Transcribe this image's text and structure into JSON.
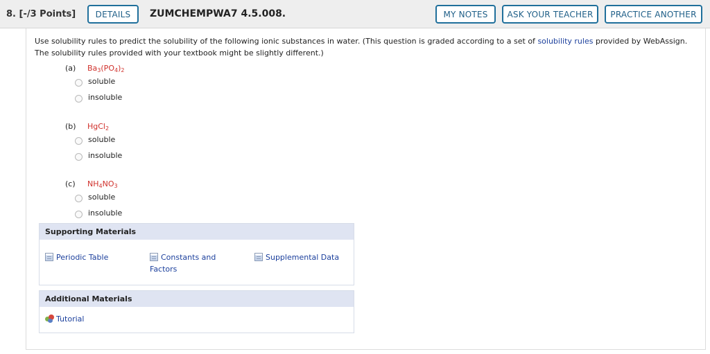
{
  "header": {
    "question_number": "8.",
    "points": "[-/3 Points]",
    "details_label": "DETAILS",
    "question_id": "ZUMCHEMPWA7 4.5.008.",
    "my_notes_label": "MY NOTES",
    "ask_teacher_label": "ASK YOUR TEACHER",
    "practice_another_label": "PRACTICE ANOTHER"
  },
  "instructions": {
    "text_before_link": "Use solubility rules to predict the solubility of the following ionic substances in water. (This question is graded according to a set of ",
    "link_text": "solubility rules",
    "text_after_link": " provided by WebAssign. The solubility rules provided with your textbook might be slightly different.)"
  },
  "parts": [
    {
      "label": "(a)",
      "formula": [
        {
          "t": "Ba",
          "sub": false
        },
        {
          "t": "3",
          "sub": true
        },
        {
          "t": "(PO",
          "sub": false
        },
        {
          "t": "4",
          "sub": true
        },
        {
          "t": ")",
          "sub": false
        },
        {
          "t": "2",
          "sub": true
        }
      ],
      "options": [
        "soluble",
        "insoluble"
      ]
    },
    {
      "label": "(b)",
      "formula": [
        {
          "t": "HgCl",
          "sub": false
        },
        {
          "t": "2",
          "sub": true
        }
      ],
      "options": [
        "soluble",
        "insoluble"
      ]
    },
    {
      "label": "(c)",
      "formula": [
        {
          "t": "NH",
          "sub": false
        },
        {
          "t": "4",
          "sub": true
        },
        {
          "t": "NO",
          "sub": false
        },
        {
          "t": "3",
          "sub": true
        }
      ],
      "options": [
        "soluble",
        "insoluble"
      ]
    }
  ],
  "supporting_materials": {
    "title": "Supporting Materials",
    "links": [
      "Periodic Table",
      "Constants and Factors",
      "Supplemental Data"
    ],
    "icon": "document-icon"
  },
  "additional_materials": {
    "title": "Additional Materials",
    "links": [
      "Tutorial"
    ],
    "icon": "tutorial-icon"
  },
  "colors": {
    "accent": "#1f6f9b",
    "formula": "#d0302b",
    "link": "#1b3f9c",
    "materials_header": "#dfe4f2"
  }
}
